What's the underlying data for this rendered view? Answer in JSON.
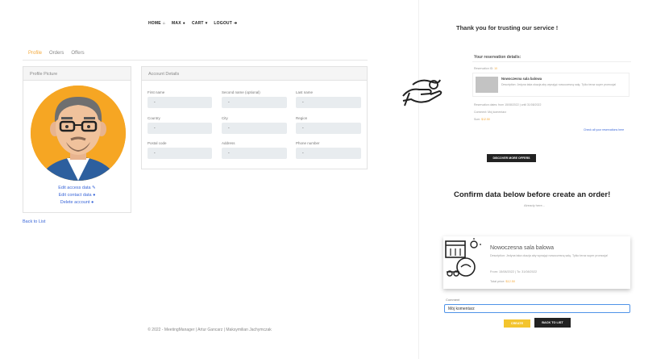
{
  "nav": {
    "home": "HOME",
    "user": "MAX",
    "cart": "CART",
    "logout": "LOGOUT"
  },
  "tabs": [
    {
      "label": "Profile",
      "active": true
    },
    {
      "label": "Orders",
      "active": false
    },
    {
      "label": "Offers",
      "active": false
    }
  ],
  "profile_card": {
    "title": "Profile Picture",
    "links": [
      "Edit access data",
      "Edit contact data",
      "Delete account"
    ]
  },
  "account": {
    "title": "Account Details",
    "fields": [
      {
        "label": "First name",
        "value": "-"
      },
      {
        "label": "Second name (optional)",
        "value": "-"
      },
      {
        "label": "Last name",
        "value": "-"
      },
      {
        "label": "Country",
        "value": "-"
      },
      {
        "label": "City",
        "value": "-"
      },
      {
        "label": "Region",
        "value": "-"
      },
      {
        "label": "Postal code",
        "value": "-"
      },
      {
        "label": "Address",
        "value": "-"
      },
      {
        "label": "Phone number",
        "value": "-"
      }
    ]
  },
  "back_to_list": "Back to List",
  "footer": "© 2022 - MeetingManager | Artur Gancarz | Maksymilian Jachymczak",
  "thanks": {
    "heading": "Thank you for trusting our service !",
    "details_title": "Your reservation details:",
    "reservation_id_label": "Reservation ID:",
    "reservation_id": "10",
    "item_name": "Nowoczesna sala balowa",
    "item_desc": "Description: Jedyna taka okazja aby wynająć nowoczesną salę. Tylko teraz super promocja!",
    "dates": "Reservation dates: from 15/08/2022 | until 31/08/2022",
    "comment": "Comment: Mój komentarz",
    "total_label": "Sum:",
    "total": "$12.50",
    "check_link": "Check all your reservations here",
    "discover_btn": "DISCOVER MORE OFFERS"
  },
  "confirm": {
    "heading": "Confirm data below before create an order!",
    "sub": "Already here...",
    "item_name": "Nowoczesna sala balowa",
    "item_desc": "Description: Jedyna taka okazja aby wynająć nowoczesną salę. Tylko teraz super promocja!",
    "dates": "From: 15/08/2022 | To: 31/08/2022",
    "total_label": "Total price:",
    "total": "$12.50",
    "comment_label": "Comment",
    "comment_value": "Mój komentarz",
    "create_btn": "CREATE",
    "back_btn": "BACK TO LIST"
  },
  "colors": {
    "accent": "#f4a93b",
    "link": "#3b67d8",
    "dark": "#222222",
    "yellow": "#f3c42d"
  }
}
